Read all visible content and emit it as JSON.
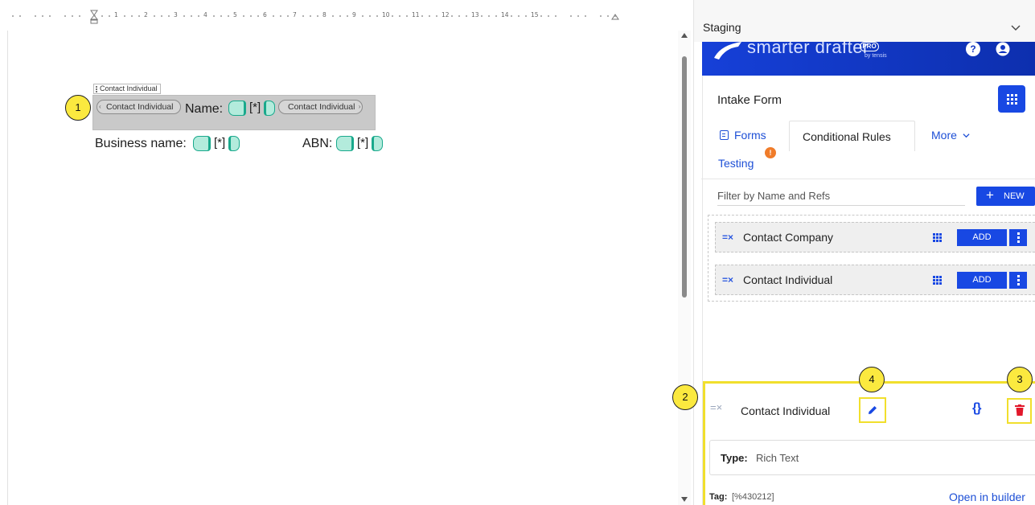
{
  "document": {
    "ruler_numbers": [
      "1",
      "2",
      "3",
      "4",
      "5",
      "6",
      "7",
      "8",
      "9",
      "10",
      "11",
      "12",
      "13",
      "14",
      "15"
    ],
    "content_control_tab": "Contact Individual",
    "tag_open": "Contact Individual",
    "tag_close": "Contact Individual",
    "name_label": "Name:",
    "name_value": "[*]",
    "business_label": "Business name:",
    "business_value": "[*]",
    "abn_label": "ABN:",
    "abn_value": "[*]"
  },
  "callouts": [
    "1",
    "2",
    "3",
    "4"
  ],
  "pane": {
    "title": "Staging",
    "brand": {
      "name": "smarter drafter",
      "pro": "PRO",
      "by": "by tensis"
    },
    "form_title": "Intake Form",
    "tabs": {
      "forms": "Forms",
      "conditional_rules": "Conditional Rules",
      "more": "More",
      "testing": "Testing",
      "testing_badge": "!"
    },
    "filter_placeholder": "Filter by Name and Refs",
    "new_button": "NEW",
    "rules": [
      {
        "name": "Contact Company",
        "add_label": "ADD"
      },
      {
        "name": "Contact Individual",
        "add_label": "ADD"
      }
    ],
    "detail": {
      "name": "Contact Individual",
      "braces": "{}",
      "type_label": "Type:",
      "type_value": "Rich Text",
      "tag_label": "Tag:",
      "tag_value": "[%430212]",
      "open_in_builder": "Open in builder"
    }
  },
  "colors": {
    "accent": "#1848e3",
    "brand_bar": "#1236c2",
    "highlight": "#f1df2c",
    "callout": "#fbe93f",
    "field": "#b3ebdc",
    "field_border": "#19a98c",
    "delete": "#e2182b",
    "warning": "#f07c2a"
  }
}
